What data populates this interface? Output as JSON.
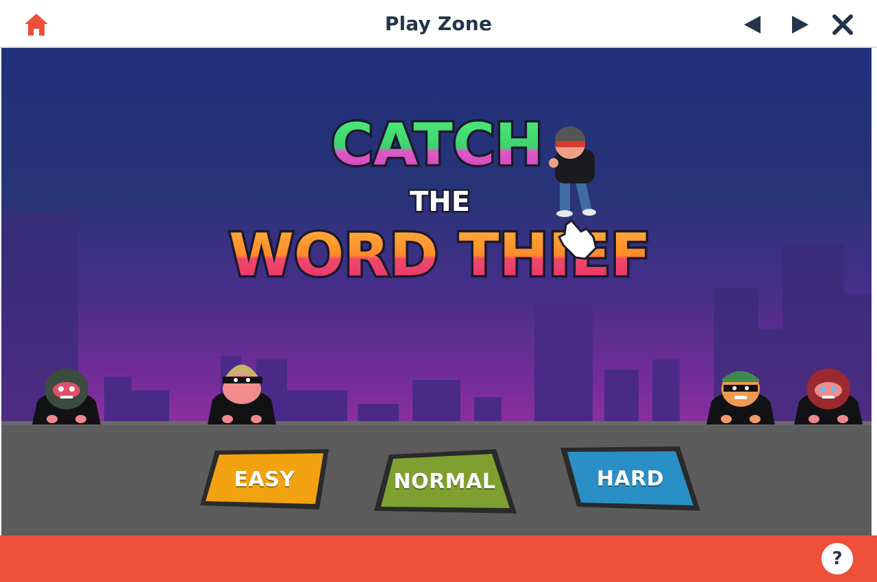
{
  "header": {
    "title": "Play Zone",
    "home_icon": "home-icon",
    "prev_icon": "arrow-left-icon",
    "next_icon": "arrow-right-icon",
    "close_icon": "close-icon"
  },
  "game": {
    "logo_line1": "CATCH",
    "logo_line2": "THE",
    "logo_line3": "WORD THIEF",
    "difficulty": [
      {
        "label": "EASY",
        "color": "#f2a210"
      },
      {
        "label": "NORMAL",
        "color": "#7fa030"
      },
      {
        "label": "HARD",
        "color": "#2a8fc4"
      }
    ]
  },
  "footer": {
    "help_label": "?"
  },
  "colors": {
    "accent": "#ed4f38",
    "title_text": "#24344a",
    "sky_top": "#20307a",
    "sky_bottom": "#8a2fa0"
  }
}
